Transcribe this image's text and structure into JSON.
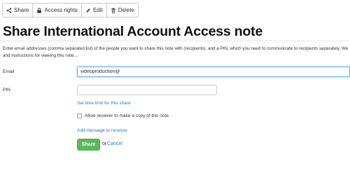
{
  "toolbar": {
    "buttons": [
      {
        "label": "Share",
        "icon": "share-icon"
      },
      {
        "label": "Access rights",
        "icon": "lock-icon"
      },
      {
        "label": "Edit",
        "icon": "pencil-icon"
      },
      {
        "label": "Delete",
        "icon": "trash-icon"
      }
    ]
  },
  "page": {
    "title": "Share International Account Access note",
    "intro_line1": "Enter email addresses (comma separated list) of the people you want to share this note with (recipients), and a PIN, which you need to communicate to recipients separately. We",
    "intro_line2": "and instructions for viewing this note..."
  },
  "form": {
    "email_label": "Email",
    "email_value": "videoproduction@",
    "pin_label": "PIN",
    "pin_value": "",
    "time_limit_link": "Set time limit for this share",
    "copy_checkbox_label": "Allow receiver to make a copy of this note",
    "copy_checkbox_checked": false,
    "add_message_link": "Add message to receiver",
    "share_button": "Share",
    "or_text": "or",
    "cancel_link": "Cancel"
  },
  "colors": {
    "link": "#2a7ab0",
    "share_button": "#5cb85c",
    "focus_border": "#66afe9"
  }
}
